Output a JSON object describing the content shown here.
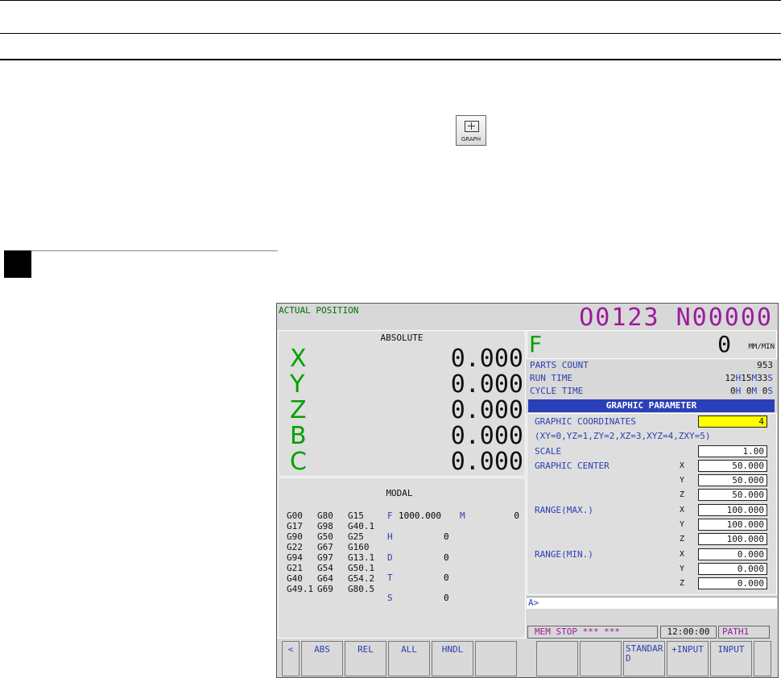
{
  "graph_key": {
    "label": "GRAPH"
  },
  "screen": {
    "title": "ACTUAL POSITION",
    "program": "O0123 N00000",
    "absolute": {
      "heading": "ABSOLUTE",
      "axes": [
        {
          "axis": "X",
          "value": "0.000"
        },
        {
          "axis": "Y",
          "value": "0.000"
        },
        {
          "axis": "Z",
          "value": "0.000"
        },
        {
          "axis": "B",
          "value": "0.000"
        },
        {
          "axis": "C",
          "value": "0.000"
        }
      ]
    },
    "modal": {
      "heading": "MODAL",
      "gcodes": [
        [
          "G00",
          "G80",
          "G15"
        ],
        [
          "G17",
          "G98",
          "G40.1"
        ],
        [
          "G90",
          "G50",
          "G25"
        ],
        [
          "G22",
          "G67",
          "G160"
        ],
        [
          "G94",
          "G97",
          "G13.1"
        ],
        [
          "G21",
          "G54",
          "G50.1"
        ],
        [
          "G40",
          "G64",
          "G54.2"
        ],
        [
          "G49.1",
          "G69",
          "G80.5"
        ]
      ],
      "f_label": "F",
      "f_value": "1000.000",
      "m_label": "M",
      "m_value": "0",
      "h_label": "H",
      "h_value": "0",
      "d_label": "D",
      "d_value": "0",
      "t_label": "T",
      "t_value": "0",
      "s_label": "S",
      "s_value": "0"
    },
    "feed": {
      "label": "F",
      "value": "0",
      "unit": "MM/MIN"
    },
    "info": {
      "parts_count_label": "PARTS COUNT",
      "parts_count": "953",
      "run_time_label": "RUN TIME",
      "run_h": "12",
      "run_m": "15",
      "run_s": "33",
      "cycle_time_label": "CYCLE TIME",
      "cyc_h": "0",
      "cyc_m": "0",
      "cyc_s": "0",
      "h": "H",
      "m": "M",
      "s": "S"
    },
    "graphic_parameter": {
      "title": "GRAPHIC PARAMETER",
      "coord_label": "GRAPHIC COORDINATES",
      "coord_value": "4",
      "coord_hint": "(XY=0,YZ=1,ZY=2,XZ=3,XYZ=4,ZXY=5)",
      "scale_label": "SCALE",
      "scale_value": "1.00",
      "center_label": "GRAPHIC CENTER",
      "center": [
        {
          "axis": "X",
          "value": "50.000"
        },
        {
          "axis": "Y",
          "value": "50.000"
        },
        {
          "axis": "Z",
          "value": "50.000"
        }
      ],
      "range_max_label": "RANGE(MAX.)",
      "range_max": [
        {
          "axis": "X",
          "value": "100.000"
        },
        {
          "axis": "Y",
          "value": "100.000"
        },
        {
          "axis": "Z",
          "value": "100.000"
        }
      ],
      "range_min_label": "RANGE(MIN.)",
      "range_min": [
        {
          "axis": "X",
          "value": "0.000"
        },
        {
          "axis": "Y",
          "value": "0.000"
        },
        {
          "axis": "Z",
          "value": "0.000"
        }
      ]
    },
    "input_prompt": "A>",
    "status": {
      "mode": "MEM  STOP *** ***",
      "clock": "12:00:00",
      "path": "PATH1"
    },
    "softkeys": [
      "<",
      "ABS",
      "REL",
      "ALL",
      "HNDL",
      "",
      "",
      "",
      "STANDARD",
      "+INPUT",
      "INPUT",
      ""
    ]
  }
}
